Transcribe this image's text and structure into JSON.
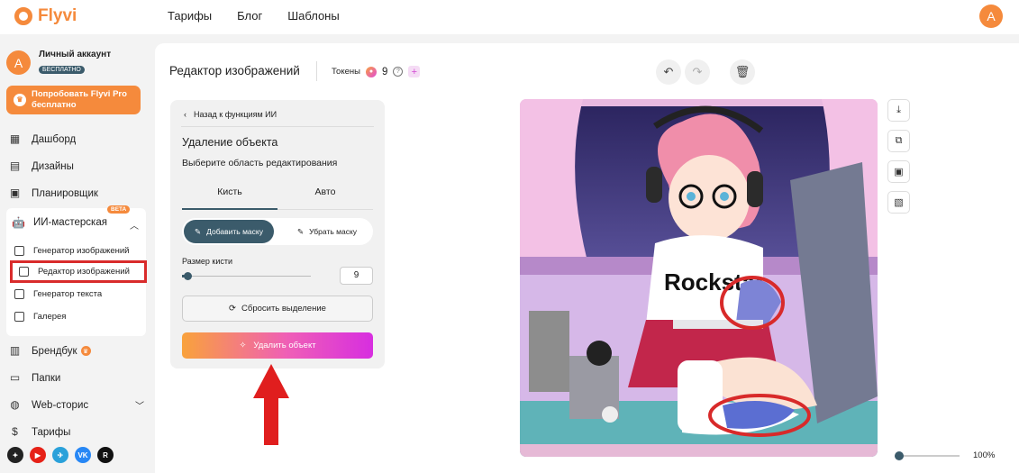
{
  "brand": {
    "name": "Flyvi"
  },
  "topnav": {
    "items": [
      "Тарифы",
      "Блог",
      "Шаблоны"
    ]
  },
  "user": {
    "initial": "A"
  },
  "sidebar": {
    "account_name": "Личный аккаунт",
    "account_badge": "БЕСПЛАТНО",
    "promo_line1": "Попробовать Flyvi Pro",
    "promo_line2": "бесплатно",
    "items": [
      {
        "label": "Дашборд",
        "icon": "grid-icon"
      },
      {
        "label": "Дизайны",
        "icon": "document-icon"
      },
      {
        "label": "Планировщик",
        "icon": "calendar-icon"
      }
    ],
    "ai": {
      "label": "ИИ-мастерская",
      "badge": "BETA",
      "items": [
        "Генератор изображений",
        "Редактор изображений",
        "Генератор текста",
        "Галерея"
      ]
    },
    "items2": [
      {
        "label": "Брендбук",
        "icon": "book-icon"
      },
      {
        "label": "Папки",
        "icon": "folder-icon"
      },
      {
        "label": "Web-сторис",
        "icon": "globe-icon"
      },
      {
        "label": "Тарифы",
        "icon": "dollar-icon"
      }
    ],
    "socials": [
      {
        "name": "compass",
        "text": "✦",
        "color": "#222222"
      },
      {
        "name": "youtube",
        "text": "▶",
        "color": "#e62117"
      },
      {
        "name": "telegram",
        "text": "✈",
        "color": "#2aa1da"
      },
      {
        "name": "vk",
        "text": "VK",
        "color": "#2787f5"
      },
      {
        "name": "rutube",
        "text": "R",
        "color": "#111111"
      }
    ]
  },
  "editor": {
    "title": "Редактор изображений",
    "tokens_label": "Токены",
    "tokens_value": "9",
    "back": "Назад к функциям ИИ",
    "panel_title": "Удаление объекта",
    "panel_sub": "Выберите область редактирования",
    "tabs": [
      "Кисть",
      "Авто"
    ],
    "add_mask": "Добавить маску",
    "remove_mask": "Убрать маску",
    "brush_label": "Размер кисти",
    "brush_size": 9,
    "brush_fraction": 0.04,
    "brush_value": "9",
    "reset": "Сбросить выделение",
    "delete": "Удалить объект",
    "zoom": "100%",
    "zoom_fraction": 0.0
  },
  "image": {
    "shirt_text": "Rockstar"
  },
  "colors": {
    "accent": "#f58a3c",
    "primary": "#3b5b6b",
    "highlight": "#d92b2b"
  }
}
